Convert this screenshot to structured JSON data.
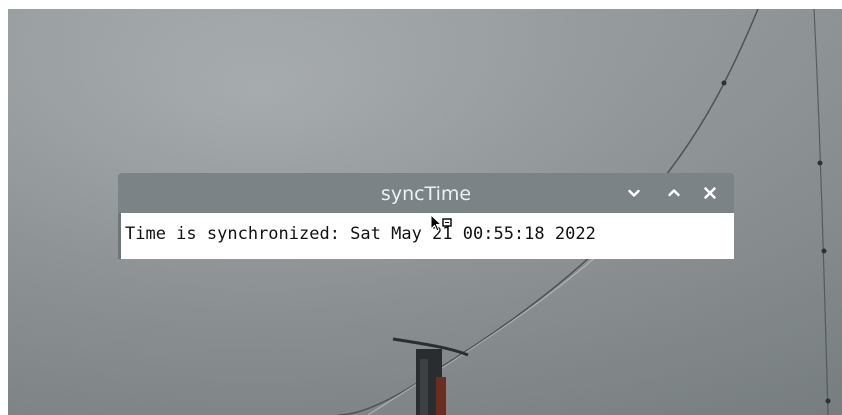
{
  "window": {
    "title": "syncTime",
    "message": "Time is synchronized: Sat May 21 00:55:18 2022",
    "controls": {
      "minimize_icon": "chevron-down-icon",
      "maximize_icon": "chevron-up-icon",
      "close_icon": "close-icon"
    }
  },
  "colors": {
    "titlebar": "#7b8386",
    "title_text": "#eef1f2",
    "content_bg": "#ffffff",
    "message_text": "#111111"
  }
}
